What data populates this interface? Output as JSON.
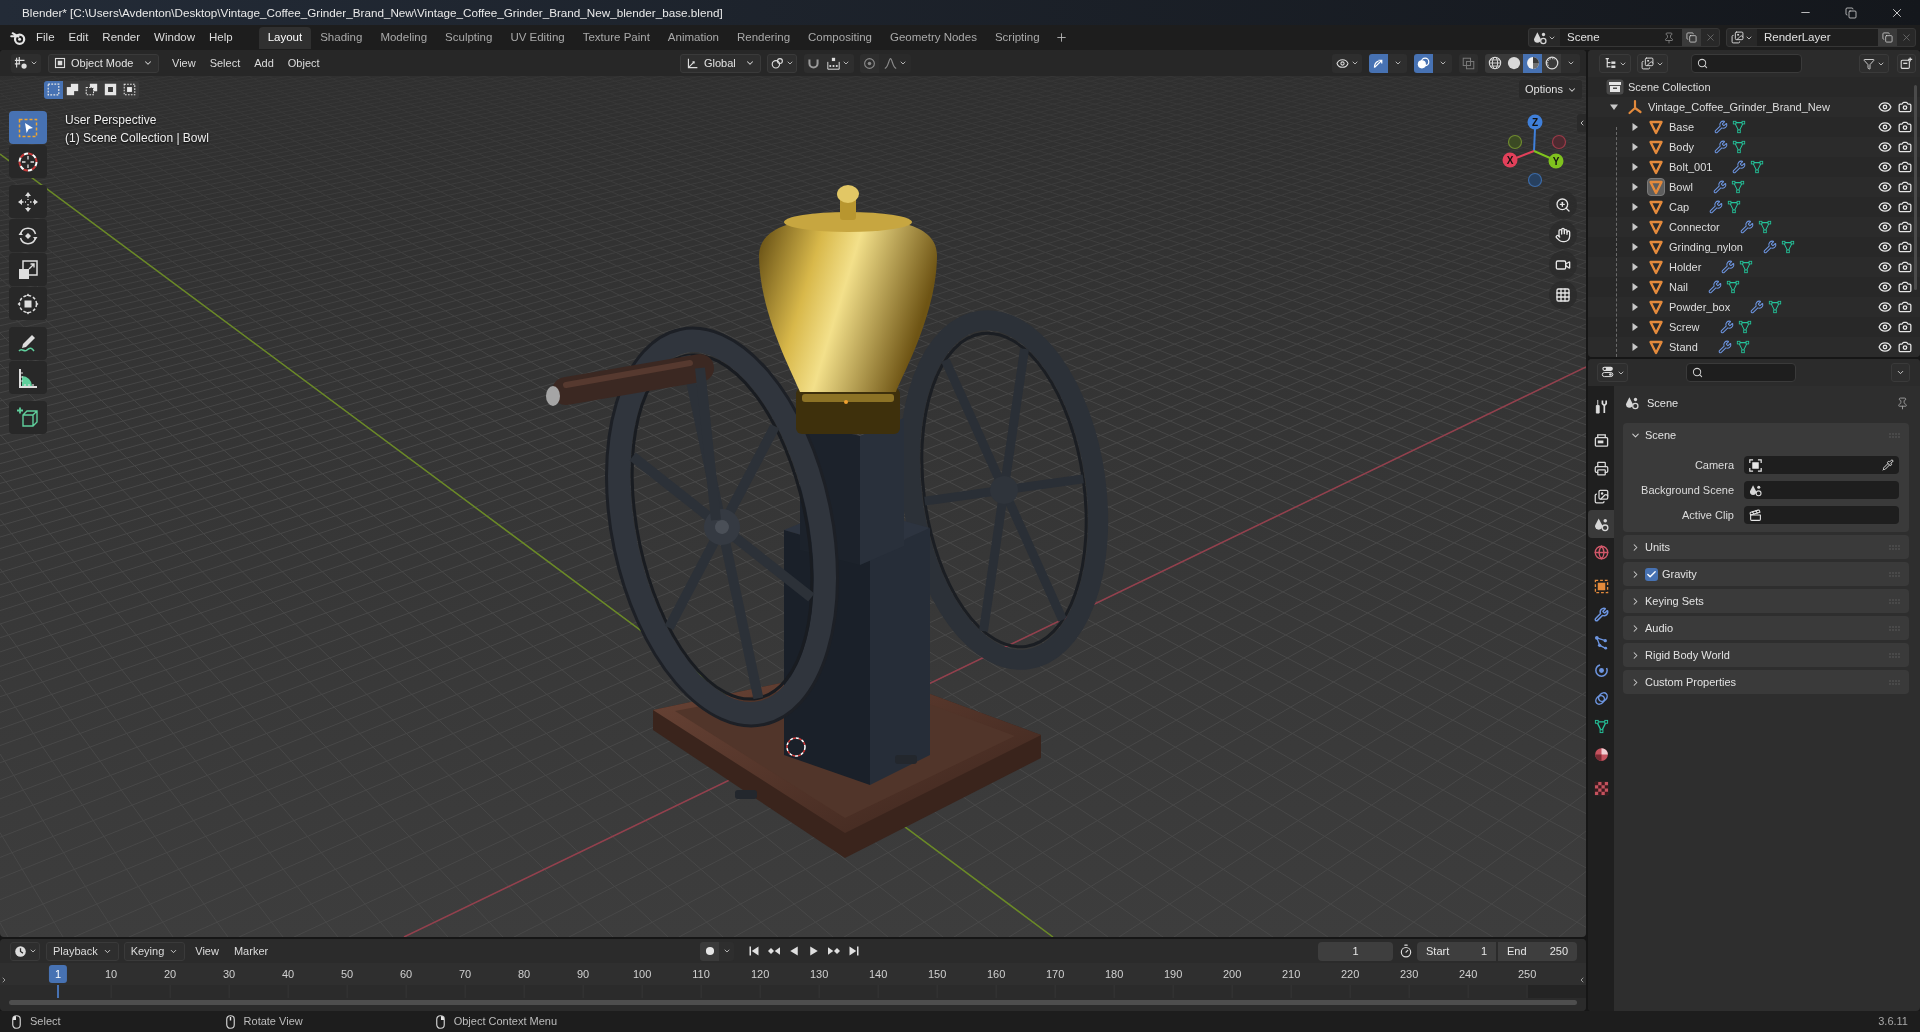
{
  "window": {
    "title": "Blender* [C:\\Users\\Avdenton\\Desktop\\Vintage_Coffee_Grinder_Brand_New\\Vintage_Coffee_Grinder_Brand_New_blender_base.blend]"
  },
  "top_bar": {
    "menus": [
      "File",
      "Edit",
      "Render",
      "Window",
      "Help"
    ],
    "workspaces": [
      {
        "label": "Layout",
        "selected": true
      },
      {
        "label": "Shading",
        "selected": false
      },
      {
        "label": "Modeling",
        "selected": false
      },
      {
        "label": "Sculpting",
        "selected": false
      },
      {
        "label": "UV Editing",
        "selected": false
      },
      {
        "label": "Texture Paint",
        "selected": false
      },
      {
        "label": "Animation",
        "selected": false
      },
      {
        "label": "Rendering",
        "selected": false
      },
      {
        "label": "Compositing",
        "selected": false
      },
      {
        "label": "Geometry Nodes",
        "selected": false
      },
      {
        "label": "Scripting",
        "selected": false
      }
    ],
    "scene": "Scene",
    "view_layer": "RenderLayer"
  },
  "viewport": {
    "header": {
      "mode": "Object Mode",
      "menus": [
        "View",
        "Select",
        "Add",
        "Object"
      ],
      "orientation": "Global",
      "snap": {
        "on": false
      },
      "proportional": {
        "on": false
      },
      "gizmos": {
        "on": true
      },
      "overlays": {
        "on": true
      },
      "xray": {
        "on": false
      },
      "shading": [
        {
          "kind": "wireframe",
          "selected": false
        },
        {
          "kind": "solid",
          "selected": false
        },
        {
          "kind": "material",
          "selected": true
        },
        {
          "kind": "rendered",
          "selected": false
        }
      ]
    },
    "options": "Options",
    "select_modes": [
      {
        "kind": "set",
        "selected": true
      },
      {
        "kind": "extend",
        "selected": false
      },
      {
        "kind": "subtract",
        "selected": false
      },
      {
        "kind": "invert",
        "selected": false
      },
      {
        "kind": "intersect",
        "selected": false
      }
    ],
    "tool_groups": [
      {
        "tools": [
          {
            "kind": "select_box",
            "selected": true
          },
          {
            "kind": "cursor",
            "selected": false
          }
        ]
      },
      {
        "tools": [
          {
            "kind": "move",
            "selected": false
          },
          {
            "kind": "rotate",
            "selected": false
          },
          {
            "kind": "scale",
            "selected": false
          },
          {
            "kind": "transform",
            "selected": false
          }
        ]
      },
      {
        "tools": [
          {
            "kind": "annotate",
            "selected": false
          },
          {
            "kind": "measure",
            "selected": false
          }
        ]
      },
      {
        "tools": [
          {
            "kind": "add_cube",
            "selected": false
          }
        ]
      }
    ],
    "info": [
      "User Perspective",
      "(1) Scene Collection | Bowl"
    ],
    "gizmo": {
      "x": "X",
      "y": "Y",
      "z": "Z"
    }
  },
  "outliner": {
    "root": {
      "label": "Scene Collection",
      "kind": "collection",
      "children": [
        {
          "label": "Vintage_Coffee_Grinder_Brand_New",
          "kind": "empty",
          "expanded": true,
          "active": false,
          "visible": true,
          "renderable": true,
          "children": [
            {
              "label": "Base",
              "kind": "mesh",
              "expanded": false,
              "active": false,
              "visible": true,
              "renderable": true
            },
            {
              "label": "Body",
              "kind": "mesh",
              "expanded": false,
              "active": false,
              "visible": true,
              "renderable": true
            },
            {
              "label": "Bolt_001",
              "kind": "mesh",
              "expanded": false,
              "active": false,
              "visible": true,
              "renderable": true
            },
            {
              "label": "Bowl",
              "kind": "mesh",
              "expanded": false,
              "active": true,
              "visible": true,
              "renderable": true
            },
            {
              "label": "Cap",
              "kind": "mesh",
              "expanded": false,
              "active": false,
              "visible": true,
              "renderable": true
            },
            {
              "label": "Connector",
              "kind": "mesh",
              "expanded": false,
              "active": false,
              "visible": true,
              "renderable": true
            },
            {
              "label": "Grinding_nylon",
              "kind": "mesh",
              "expanded": false,
              "active": false,
              "visible": true,
              "renderable": true
            },
            {
              "label": "Holder",
              "kind": "mesh",
              "expanded": false,
              "active": false,
              "visible": true,
              "renderable": true
            },
            {
              "label": "Nail",
              "kind": "mesh",
              "expanded": false,
              "active": false,
              "visible": true,
              "renderable": true
            },
            {
              "label": "Powder_box",
              "kind": "mesh",
              "expanded": false,
              "active": false,
              "visible": true,
              "renderable": true
            },
            {
              "label": "Screw",
              "kind": "mesh",
              "expanded": false,
              "active": false,
              "visible": true,
              "renderable": true
            },
            {
              "label": "Stand",
              "kind": "mesh",
              "expanded": false,
              "active": false,
              "visible": true,
              "renderable": true
            }
          ]
        }
      ]
    }
  },
  "properties": {
    "tab_groups": [
      {
        "tabs": [
          {
            "kind": "tool",
            "selected": false
          }
        ]
      },
      {
        "tabs": [
          {
            "kind": "render",
            "selected": false
          },
          {
            "kind": "output",
            "selected": false
          },
          {
            "kind": "view_layer",
            "selected": false
          },
          {
            "kind": "scene",
            "selected": true
          },
          {
            "kind": "world",
            "selected": false
          }
        ]
      },
      {
        "tabs": [
          {
            "kind": "object",
            "selected": false
          },
          {
            "kind": "modifiers",
            "selected": false
          },
          {
            "kind": "particles",
            "selected": false
          },
          {
            "kind": "physics",
            "selected": false
          },
          {
            "kind": "constraints",
            "selected": false
          },
          {
            "kind": "data",
            "selected": false
          },
          {
            "kind": "material",
            "selected": false
          }
        ]
      },
      {
        "tabs": [
          {
            "kind": "texture",
            "selected": false
          }
        ]
      }
    ],
    "context": "Scene",
    "panels": [
      {
        "title": "Scene",
        "expanded": true,
        "fields": [
          {
            "label": "Camera",
            "kind": "camera"
          },
          {
            "label": "Background Scene",
            "kind": "scene"
          },
          {
            "label": "Active Clip",
            "kind": "clip"
          }
        ]
      },
      {
        "title": "Units",
        "expanded": false
      },
      {
        "title": "Gravity",
        "expanded": false,
        "checked": true
      },
      {
        "title": "Keying Sets",
        "expanded": false
      },
      {
        "title": "Audio",
        "expanded": false
      },
      {
        "title": "Rigid Body World",
        "expanded": false
      },
      {
        "title": "Custom Properties",
        "expanded": false
      }
    ]
  },
  "timeline": {
    "menus": [
      {
        "label": "Playback",
        "kind": "dropdown"
      },
      {
        "label": "Keying",
        "kind": "dropdown"
      },
      {
        "label": "View",
        "kind": "menu"
      },
      {
        "label": "Marker",
        "kind": "menu"
      }
    ],
    "auto_keying": {
      "on": false
    },
    "current_frame": "1",
    "start": {
      "label": "Start",
      "value": "1"
    },
    "end": {
      "label": "End",
      "value": "250"
    },
    "playhead": "1",
    "ruler": [
      "10",
      "20",
      "30",
      "40",
      "50",
      "60",
      "70",
      "80",
      "90",
      "100",
      "110",
      "120",
      "130",
      "140",
      "150",
      "160",
      "170",
      "180",
      "190",
      "200",
      "210",
      "220",
      "230",
      "240",
      "250"
    ]
  },
  "status_bar": {
    "hints": [
      {
        "kind": "left_click",
        "label": "Select"
      },
      {
        "kind": "middle_click",
        "label": "Rotate View"
      },
      {
        "kind": "right_click",
        "label": "Object Context Menu"
      }
    ],
    "version": "3.6.11"
  }
}
